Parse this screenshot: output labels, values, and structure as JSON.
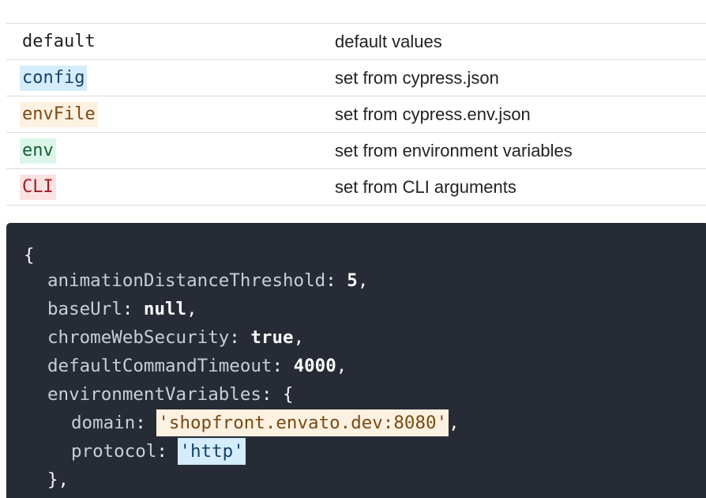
{
  "legend": {
    "rows": [
      {
        "key": "default",
        "desc": "default values"
      },
      {
        "key": "config",
        "desc": "set from cypress.json",
        "bg": "#d4ecfb",
        "fg": "#15426b"
      },
      {
        "key": "envFile",
        "desc": "set from cypress.env.json",
        "bg": "#fdf1e2",
        "fg": "#7a4a12"
      },
      {
        "key": "env",
        "desc": "set from environment variables",
        "bg": "#dcf7ea",
        "fg": "#155e35"
      },
      {
        "key": "CLI",
        "desc": "set from CLI arguments",
        "bg": "#fce1e2",
        "fg": "#a11a22"
      }
    ]
  },
  "code": {
    "open_brace": "{",
    "entries": [
      {
        "key": "animationDistanceThreshold",
        "value": "5"
      },
      {
        "key": "baseUrl",
        "value": "null"
      },
      {
        "key": "chromeWebSecurity",
        "value": "true"
      },
      {
        "key": "defaultCommandTimeout",
        "value": "4000"
      }
    ],
    "env_vars": {
      "key": "environmentVariables",
      "open": "{",
      "close": "},",
      "items": [
        {
          "key": "domain",
          "value": "'shopfront.envato.dev:8080'",
          "bg": "#fdf1e2",
          "fg": "#7a4a12"
        },
        {
          "key": "protocol",
          "value": "'http'",
          "bg": "#d4ecfb",
          "fg": "#15426b"
        }
      ]
    }
  }
}
